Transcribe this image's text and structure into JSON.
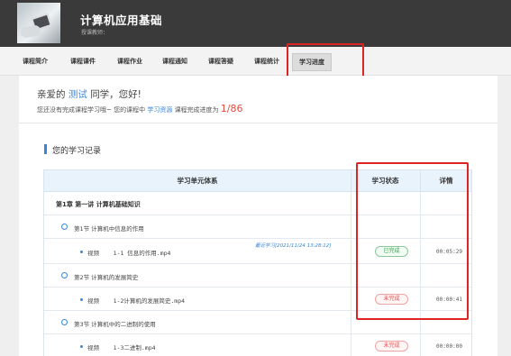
{
  "course": {
    "title": "计算机应用基础",
    "teacher_label": "授课教师："
  },
  "tabs": [
    {
      "label": "课程简介"
    },
    {
      "label": "课程课件"
    },
    {
      "label": "课程作业"
    },
    {
      "label": "课程通知"
    },
    {
      "label": "课程答疑"
    },
    {
      "label": "课程统计"
    },
    {
      "label": "学习进度",
      "active": true
    }
  ],
  "greeting": {
    "prefix": "亲爱的",
    "name": "测试",
    "suffix": "同学，您好!"
  },
  "notice": {
    "text_before": "您还没有完成课程学习哦~ 您的课程中",
    "link": "学习资源",
    "text_after": "课程完成进度为",
    "progress": "1/86"
  },
  "records": {
    "title": "您的学习记录",
    "headers": {
      "unit": "学习单元体系",
      "status": "学习状态",
      "detail": "详情"
    },
    "rows": [
      {
        "type": "chapter",
        "text": "第1章  第一讲 计算机基础知识"
      },
      {
        "type": "section",
        "text": "第1节  计算机中信息的作用"
      },
      {
        "type": "video",
        "text": "视频    1-1 信息的作用.mp4",
        "last_study": "最近学习[2021/11/24 13:28:12]",
        "status": "已完成",
        "status_kind": "done",
        "duration": "00:05:29"
      },
      {
        "type": "section",
        "text": "第2节  计算机的发展简史"
      },
      {
        "type": "video",
        "text": "视频    1-2计算机的发展简史.mp4",
        "status": "未完成",
        "status_kind": "todo",
        "duration": "00:00:41"
      },
      {
        "type": "section",
        "text": "第3节  计算机中的二进制的使用"
      },
      {
        "type": "video",
        "text": "视频    1-3二进制.mp4",
        "status": "未完成",
        "status_kind": "todo",
        "duration": "00:00:00"
      }
    ]
  },
  "colors": {
    "accent_blue": "#3a86d8",
    "highlight_red": "#e02424",
    "done_green": "#3aa24e",
    "todo_red": "#e04b4b",
    "header_bg": "#3a3a3a"
  }
}
